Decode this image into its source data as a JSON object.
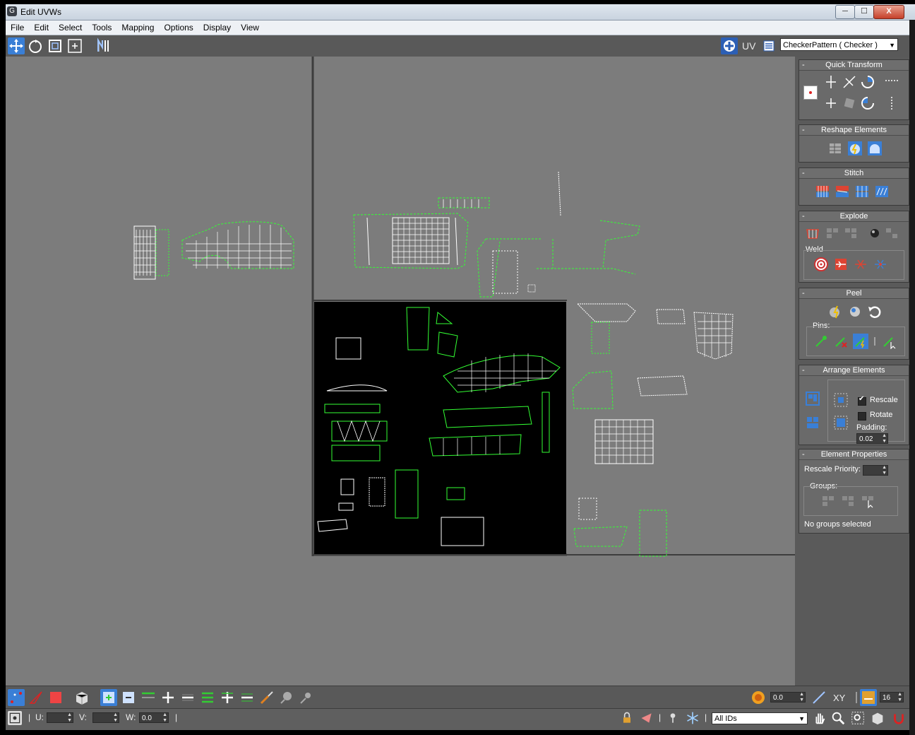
{
  "window": {
    "title": "Edit UVWs",
    "minimize_glyph": "─",
    "maximize_glyph": "☐",
    "close_glyph": "X"
  },
  "menu": [
    "File",
    "Edit",
    "Select",
    "Tools",
    "Mapping",
    "Options",
    "Display",
    "View"
  ],
  "toolbar": {
    "tools": [
      "move-icon",
      "rotate-icon",
      "scale-icon",
      "freeform-icon",
      "mirror-icon"
    ],
    "uv_label": "UV",
    "texture_dropdown": "CheckerPattern  ( Checker )"
  },
  "panel": {
    "quick_transform": {
      "title": "Quick Transform"
    },
    "reshape_elements": {
      "title": "Reshape Elements"
    },
    "stitch": {
      "title": "Stitch"
    },
    "explode": {
      "title": "Explode",
      "weld_label": "Weld"
    },
    "peel": {
      "title": "Peel",
      "pins_label": "Pins:"
    },
    "arrange_elements": {
      "title": "Arrange Elements",
      "rescale_label": "Rescale",
      "rescale_checked": true,
      "rotate_label": "Rotate",
      "rotate_checked": false,
      "padding_label": "Padding:",
      "padding_value": "0.02"
    },
    "element_properties": {
      "title": "Element Properties",
      "rescale_priority_label": "Rescale Priority:",
      "groups_label": "Groups:",
      "status": "No groups selected"
    }
  },
  "bottom": {
    "spinner_value": "0.0",
    "xy_label": "XY",
    "grid_value": "16",
    "u_label": "U:",
    "v_label": "V:",
    "w_label": "W:",
    "w_value": "0.0",
    "ids_dropdown": "All IDs"
  },
  "colors": {
    "viewport_bg": "#7c7c7c",
    "uv_edge": "#ffffff",
    "uv_open_edge": "#33ff33",
    "panel_bg": "#5a5a5a",
    "selection_blue": "#3a7fd6"
  }
}
